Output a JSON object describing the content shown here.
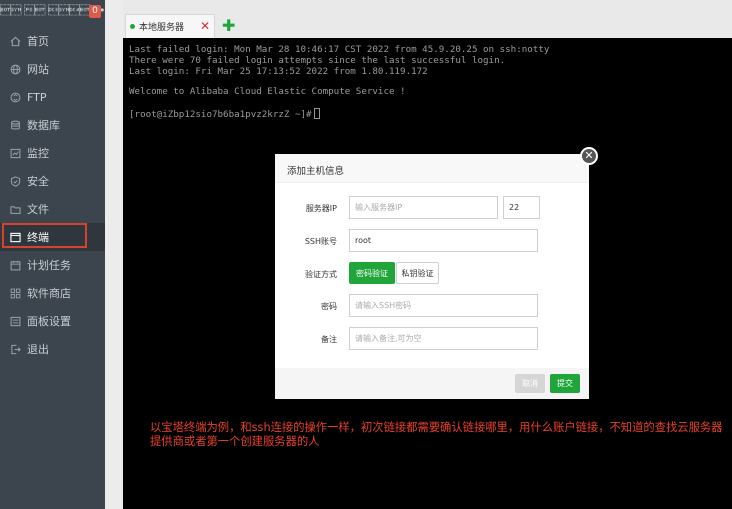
{
  "sidebar": {
    "brand": "\u0004\u0016 \u001c\u0004 \u0013\u0016\u0014\u0004 •• ●",
    "badge": "0",
    "items": [
      {
        "label": "首页",
        "icon": "home-icon"
      },
      {
        "label": "网站",
        "icon": "globe-icon"
      },
      {
        "label": "FTP",
        "icon": "ftp-icon"
      },
      {
        "label": "数据库",
        "icon": "database-icon"
      },
      {
        "label": "监控",
        "icon": "monitor-icon"
      },
      {
        "label": "安全",
        "icon": "shield-icon"
      },
      {
        "label": "文件",
        "icon": "folder-icon"
      },
      {
        "label": "终端",
        "icon": "terminal-icon"
      },
      {
        "label": "计划任务",
        "icon": "calendar-icon"
      },
      {
        "label": "软件商店",
        "icon": "apps-icon"
      },
      {
        "label": "面板设置",
        "icon": "settings-icon"
      },
      {
        "label": "退出",
        "icon": "logout-icon"
      }
    ],
    "active_index": 7
  },
  "tabs": {
    "active_label": "本地服务器",
    "close_glyph": "✕",
    "add_glyph": "✚"
  },
  "terminal": {
    "lines": [
      "Last failed login: Mon Mar 28 10:46:17 CST 2022 from 45.9.20.25 on ssh:notty",
      "There were 70 failed login attempts since the last successful login.",
      "Last login: Fri Mar 25 17:13:52 2022 from 1.80.119.172",
      "",
      "Welcome to Alibaba Cloud Elastic Compute Service !",
      "",
      "[root@iZbp12sio7b6ba1pvz2krzZ ~]#"
    ]
  },
  "dialog": {
    "title": "添加主机信息",
    "close_glyph": "✕",
    "server_ip_label": "服务器IP",
    "server_ip_placeholder": "输入服务器IP",
    "port_value": "22",
    "ssh_account_label": "SSH账号",
    "ssh_account_value": "root",
    "auth_method_label": "验证方式",
    "auth_password_button": "密码验证",
    "auth_key_button": "私钥验证",
    "password_label": "密码",
    "password_placeholder": "请输入SSH密码",
    "note_label": "备注",
    "note_placeholder": "请输入备注,可为空",
    "cancel_button": "取消",
    "submit_button": "提交"
  },
  "annotation": "以宝塔终端为例，和ssh连接的操作一样，初次链接都需要确认链接哪里，用什么账户链接，不知道的查找云服务器提供商或者第一个创建服务器的人",
  "colors": {
    "accent_green": "#20a53a",
    "sidebar_bg": "#3c444d",
    "annotation_red": "#e8412c",
    "highlight_red": "#d8412c"
  }
}
